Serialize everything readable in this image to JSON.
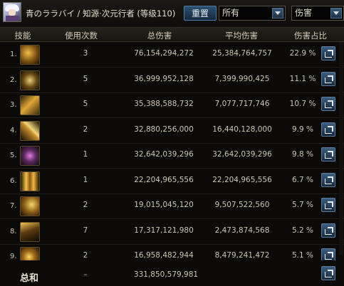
{
  "header": {
    "character_name": "青のララバイ / 知源·次元行者 (等级110)",
    "reset_button": "重置",
    "filter_select": "所有",
    "metric_select": "伤害"
  },
  "table": {
    "columns": [
      "技能",
      "使用次数",
      "总伤害",
      "平均伤害",
      "伤害占比"
    ],
    "rows": [
      {
        "index": "1.",
        "uses": "3",
        "total": "76,154,294,272",
        "average": "25,384,764,757",
        "percent": "22.9 %"
      },
      {
        "index": "2.",
        "uses": "5",
        "total": "36,999,952,128",
        "average": "7,399,990,425",
        "percent": "11.1 %"
      },
      {
        "index": "3.",
        "uses": "5",
        "total": "35,388,588,732",
        "average": "7,077,717,746",
        "percent": "10.7 %"
      },
      {
        "index": "4.",
        "uses": "2",
        "total": "32,880,256,000",
        "average": "16,440,128,000",
        "percent": "9.9 %"
      },
      {
        "index": "5.",
        "uses": "1",
        "total": "32,642,039,296",
        "average": "32,642,039,296",
        "percent": "9.8 %"
      },
      {
        "index": "6.",
        "uses": "1",
        "total": "22,204,965,556",
        "average": "22,204,965,556",
        "percent": "6.7 %"
      },
      {
        "index": "7.",
        "uses": "2",
        "total": "19,015,045,120",
        "average": "9,507,522,560",
        "percent": "5.7 %"
      },
      {
        "index": "8.",
        "uses": "7",
        "total": "17,317,121,980",
        "average": "2,473,874,568",
        "percent": "5.2 %"
      },
      {
        "index": "9.",
        "uses": "2",
        "total": "16,958,482,944",
        "average": "8,479,241,472",
        "percent": "5.1 %"
      }
    ],
    "total": {
      "label": "总和",
      "uses": "–",
      "total": "331,850,579,981"
    }
  },
  "icons": {
    "skill_icons": [
      "skill-1-icon",
      "skill-2-icon",
      "skill-3-icon",
      "skill-4-icon",
      "skill-5-icon",
      "skill-6-icon",
      "skill-7-icon",
      "skill-8-icon",
      "skill-9-icon"
    ],
    "share": "share-icon"
  },
  "colors": {
    "accent_blue": "#3b5e82",
    "text": "#cbc4b2",
    "background": "#0b0a08"
  }
}
